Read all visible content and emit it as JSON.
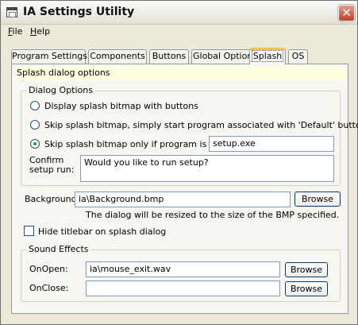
{
  "window": {
    "title": "IA Settings Utility",
    "close_glyph": "✕"
  },
  "menu": {
    "file": "File",
    "help": "Help"
  },
  "tabs": [
    {
      "label": "Program Settings"
    },
    {
      "label": "Components"
    },
    {
      "label": "Buttons"
    },
    {
      "label": "Global Options"
    },
    {
      "label": "Splash",
      "active": true
    },
    {
      "label": "OS"
    }
  ],
  "panel": {
    "description": "Splash dialog options",
    "dialog_options": {
      "title": "Dialog Options",
      "options": [
        {
          "label": "Display splash bitmap with buttons",
          "checked": false
        },
        {
          "label": "Skip splash bitmap, simply start program associated with 'Default' button",
          "checked": false
        },
        {
          "label": "Skip splash bitmap only if program is named:",
          "checked": true
        }
      ],
      "program_name_value": "setup.exe",
      "confirm_label_line1": "Confirm",
      "confirm_label_line2": "setup run:",
      "confirm_text": "Would you like to run setup?"
    },
    "background": {
      "label": "Background:",
      "value": "ia\\Background.bmp",
      "browse_label": "Browse",
      "note": "The dialog will be resized to the size of the BMP specified."
    },
    "hide_titlebar": {
      "label": "Hide titlebar on splash dialog",
      "checked": false
    },
    "sound_effects": {
      "title": "Sound Effects",
      "onopen_label": "OnOpen:",
      "onopen_value": "ia\\mouse_exit.wav",
      "onclose_label": "OnClose:",
      "onclose_value": "",
      "browse_label": "Browse"
    }
  }
}
